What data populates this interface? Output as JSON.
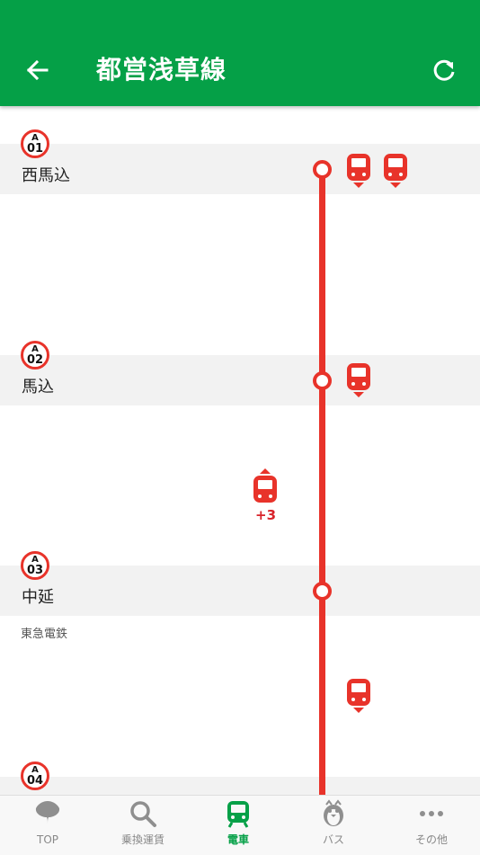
{
  "header": {
    "title": "都営浅草線",
    "back_icon": "arrow-left-icon",
    "refresh_icon": "refresh-icon",
    "background": "#05a047"
  },
  "line_color": "#e8332a",
  "stations": [
    {
      "letter": "A",
      "number": "01",
      "name": "西馬込"
    },
    {
      "letter": "A",
      "number": "02",
      "name": "馬込"
    },
    {
      "letter": "A",
      "number": "03",
      "name": "中延",
      "note": "東急電鉄"
    },
    {
      "letter": "A",
      "number": "04",
      "name": ""
    }
  ],
  "trains": {
    "extra_count": "+3"
  },
  "tabs": [
    {
      "label": "TOP",
      "icon": "tokyo-ginkgo-icon"
    },
    {
      "label": "乗換運賃",
      "icon": "search-icon"
    },
    {
      "label": "電車",
      "icon": "train-icon",
      "active": true
    },
    {
      "label": "バス",
      "icon": "penguin-bus-icon"
    },
    {
      "label": "その他",
      "icon": "more-dots-icon"
    }
  ]
}
